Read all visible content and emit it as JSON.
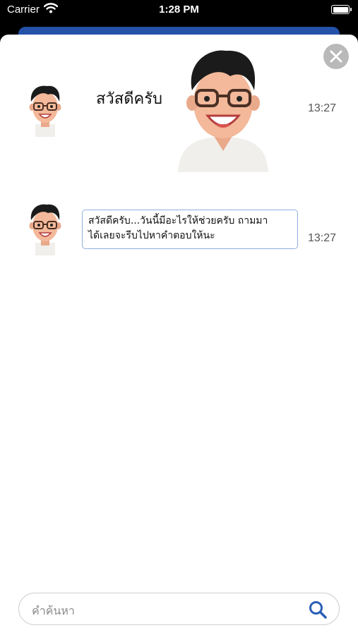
{
  "status_bar": {
    "carrier": "Carrier",
    "time": "1:28 PM"
  },
  "messages": [
    {
      "text": "สวัสดีครับ",
      "time": "13:27"
    },
    {
      "text": "สวัสดีครับ...วันนี้มีอะไรให้ช่วยครับ ถามมาได้เลยจะรีบไปหาคำตอบให้นะ",
      "line1": "สวัสดีครับ...วันนี้มีอะไรให้ช่วยครับ ถามมา",
      "line2": "ได้เลยจะรีบไปหาคำตอบให้นะ",
      "time": "13:27"
    }
  ],
  "search": {
    "placeholder": "คำค้นหา"
  },
  "colors": {
    "accent": "#2452a8",
    "close_button": "#b9b9b9",
    "bubble_border": "#8fb0e0",
    "search_icon": "#2a5fb6"
  },
  "icons": {
    "close": "close-icon",
    "search": "search-icon",
    "wifi": "wifi-icon",
    "battery": "battery-icon"
  }
}
